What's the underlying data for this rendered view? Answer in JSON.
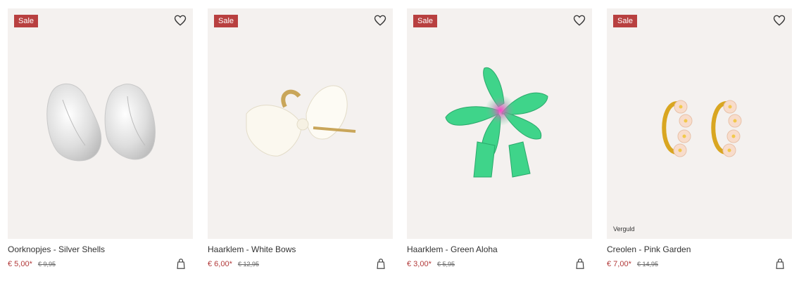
{
  "products": [
    {
      "badge": "Sale",
      "name": "Oorknopjes - Silver Shells",
      "price": "€ 5,00*",
      "old_price": "€ 9,95",
      "tag": ""
    },
    {
      "badge": "Sale",
      "name": "Haarklem - White Bows",
      "price": "€ 6,00*",
      "old_price": "€ 12,95",
      "tag": ""
    },
    {
      "badge": "Sale",
      "name": "Haarklem - Green Aloha",
      "price": "€ 3,00*",
      "old_price": "€ 5,95",
      "tag": ""
    },
    {
      "badge": "Sale",
      "name": "Creolen - Pink Garden",
      "price": "€ 7,00*",
      "old_price": "€ 14,95",
      "tag": "Verguld"
    }
  ],
  "icons": {
    "wishlist": "heart-icon",
    "cart": "shopping-bag-icon"
  },
  "colors": {
    "sale_badge": "#b84040",
    "price": "#b23a3a",
    "image_bg": "#f4f1ef"
  }
}
